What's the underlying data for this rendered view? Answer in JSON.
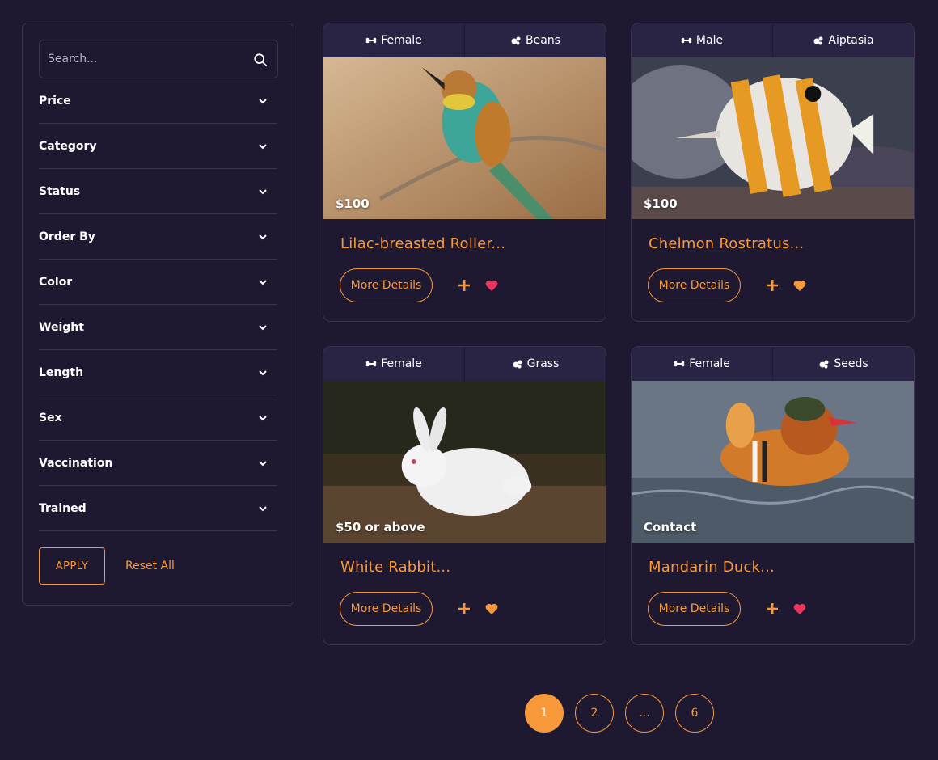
{
  "colors": {
    "background": "#1e1831",
    "accent": "#f7993a",
    "border": "#3a3452",
    "heart_red": "#e8365d"
  },
  "search": {
    "placeholder": "Search..."
  },
  "filters": [
    {
      "label": "Price"
    },
    {
      "label": "Category"
    },
    {
      "label": "Status"
    },
    {
      "label": "Order By"
    },
    {
      "label": "Color"
    },
    {
      "label": "Weight"
    },
    {
      "label": "Length"
    },
    {
      "label": "Sex"
    },
    {
      "label": "Vaccination"
    },
    {
      "label": "Trained"
    }
  ],
  "apply_label": "APPLY",
  "reset_label": "Reset All",
  "details_label": "More Details",
  "cards": [
    {
      "sex": "Female",
      "food": "Beans",
      "price": "$100",
      "title": "Lilac-breasted Roller...",
      "favorite_color": "#e8365d"
    },
    {
      "sex": "Male",
      "food": "Aiptasia",
      "price": "$100",
      "title": "Chelmon Rostratus...",
      "favorite_color": "#f7993a"
    },
    {
      "sex": "Female",
      "food": "Grass",
      "price": "$50 or above",
      "title": "White Rabbit...",
      "favorite_color": "#f7993a"
    },
    {
      "sex": "Female",
      "food": "Seeds",
      "price": "Contact",
      "title": "Mandarin Duck...",
      "favorite_color": "#e8365d"
    }
  ],
  "pagination": {
    "pages": [
      "1",
      "2",
      "...",
      "6"
    ],
    "current": "1"
  }
}
